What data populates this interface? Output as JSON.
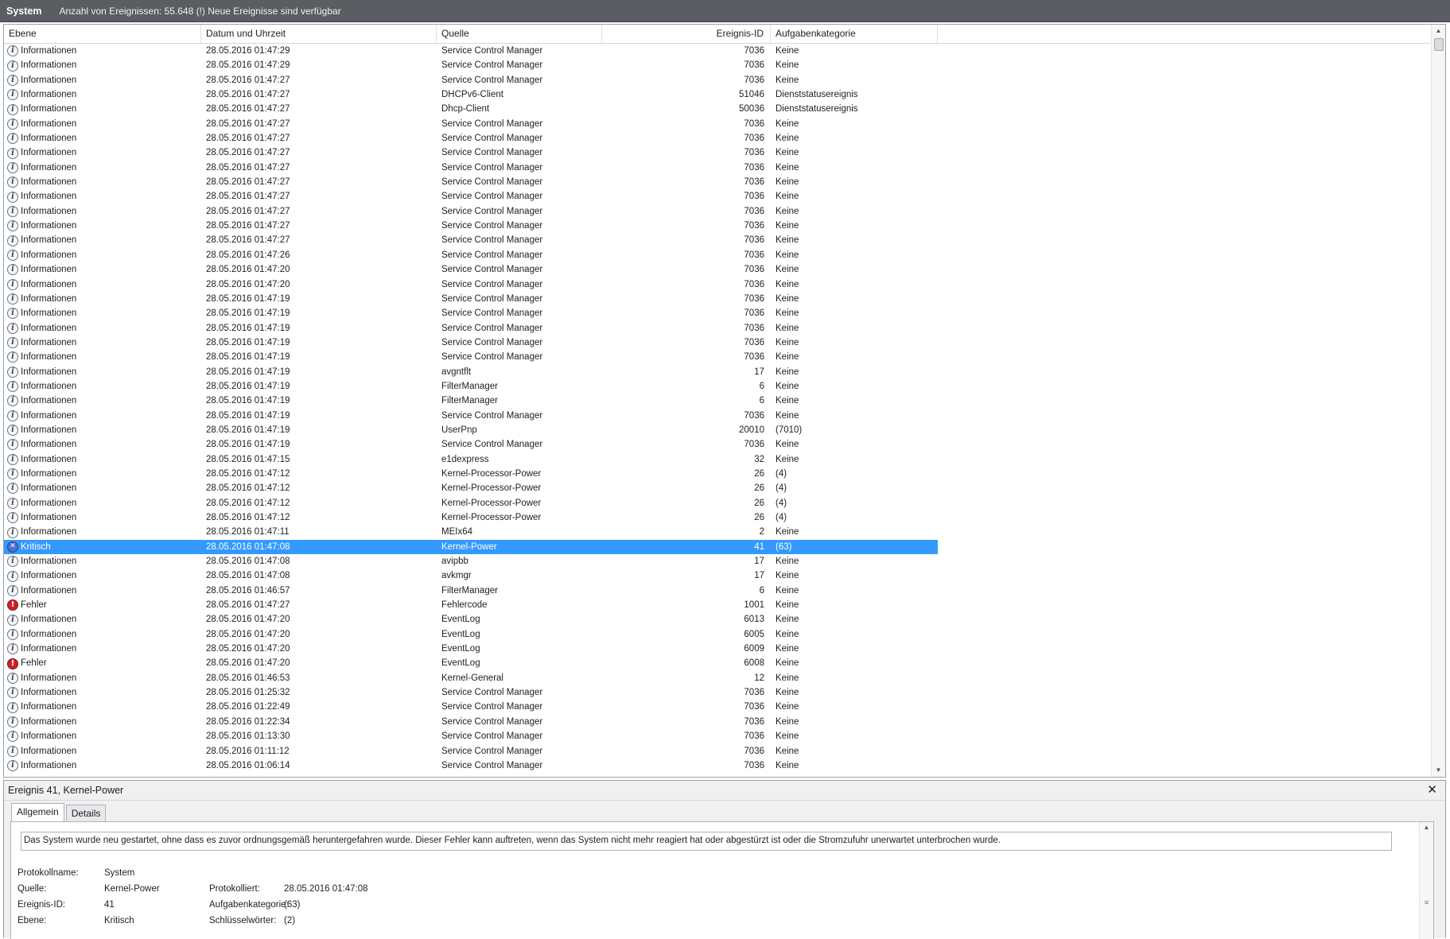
{
  "title": "System",
  "status_text": "Anzahl von Ereignissen: 55.648 (!) Neue Ereignisse sind verfügbar",
  "columns": {
    "level": "Ebene",
    "datetime": "Datum und Uhrzeit",
    "source": "Quelle",
    "event_id": "Ereignis-ID",
    "category": "Aufgabenkategorie"
  },
  "rows": [
    {
      "level": "Informationen",
      "icon": "info",
      "datetime": "28.05.2016 01:47:29",
      "source": "Service Control Manager",
      "event_id": "7036",
      "category": "Keine"
    },
    {
      "level": "Informationen",
      "icon": "info",
      "datetime": "28.05.2016 01:47:29",
      "source": "Service Control Manager",
      "event_id": "7036",
      "category": "Keine"
    },
    {
      "level": "Informationen",
      "icon": "info",
      "datetime": "28.05.2016 01:47:27",
      "source": "Service Control Manager",
      "event_id": "7036",
      "category": "Keine"
    },
    {
      "level": "Informationen",
      "icon": "info",
      "datetime": "28.05.2016 01:47:27",
      "source": "DHCPv6-Client",
      "event_id": "51046",
      "category": "Dienststatusereignis"
    },
    {
      "level": "Informationen",
      "icon": "info",
      "datetime": "28.05.2016 01:47:27",
      "source": "Dhcp-Client",
      "event_id": "50036",
      "category": "Dienststatusereignis"
    },
    {
      "level": "Informationen",
      "icon": "info",
      "datetime": "28.05.2016 01:47:27",
      "source": "Service Control Manager",
      "event_id": "7036",
      "category": "Keine"
    },
    {
      "level": "Informationen",
      "icon": "info",
      "datetime": "28.05.2016 01:47:27",
      "source": "Service Control Manager",
      "event_id": "7036",
      "category": "Keine"
    },
    {
      "level": "Informationen",
      "icon": "info",
      "datetime": "28.05.2016 01:47:27",
      "source": "Service Control Manager",
      "event_id": "7036",
      "category": "Keine"
    },
    {
      "level": "Informationen",
      "icon": "info",
      "datetime": "28.05.2016 01:47:27",
      "source": "Service Control Manager",
      "event_id": "7036",
      "category": "Keine"
    },
    {
      "level": "Informationen",
      "icon": "info",
      "datetime": "28.05.2016 01:47:27",
      "source": "Service Control Manager",
      "event_id": "7036",
      "category": "Keine"
    },
    {
      "level": "Informationen",
      "icon": "info",
      "datetime": "28.05.2016 01:47:27",
      "source": "Service Control Manager",
      "event_id": "7036",
      "category": "Keine"
    },
    {
      "level": "Informationen",
      "icon": "info",
      "datetime": "28.05.2016 01:47:27",
      "source": "Service Control Manager",
      "event_id": "7036",
      "category": "Keine"
    },
    {
      "level": "Informationen",
      "icon": "info",
      "datetime": "28.05.2016 01:47:27",
      "source": "Service Control Manager",
      "event_id": "7036",
      "category": "Keine"
    },
    {
      "level": "Informationen",
      "icon": "info",
      "datetime": "28.05.2016 01:47:27",
      "source": "Service Control Manager",
      "event_id": "7036",
      "category": "Keine"
    },
    {
      "level": "Informationen",
      "icon": "info",
      "datetime": "28.05.2016 01:47:26",
      "source": "Service Control Manager",
      "event_id": "7036",
      "category": "Keine"
    },
    {
      "level": "Informationen",
      "icon": "info",
      "datetime": "28.05.2016 01:47:20",
      "source": "Service Control Manager",
      "event_id": "7036",
      "category": "Keine"
    },
    {
      "level": "Informationen",
      "icon": "info",
      "datetime": "28.05.2016 01:47:20",
      "source": "Service Control Manager",
      "event_id": "7036",
      "category": "Keine"
    },
    {
      "level": "Informationen",
      "icon": "info",
      "datetime": "28.05.2016 01:47:19",
      "source": "Service Control Manager",
      "event_id": "7036",
      "category": "Keine"
    },
    {
      "level": "Informationen",
      "icon": "info",
      "datetime": "28.05.2016 01:47:19",
      "source": "Service Control Manager",
      "event_id": "7036",
      "category": "Keine"
    },
    {
      "level": "Informationen",
      "icon": "info",
      "datetime": "28.05.2016 01:47:19",
      "source": "Service Control Manager",
      "event_id": "7036",
      "category": "Keine"
    },
    {
      "level": "Informationen",
      "icon": "info",
      "datetime": "28.05.2016 01:47:19",
      "source": "Service Control Manager",
      "event_id": "7036",
      "category": "Keine"
    },
    {
      "level": "Informationen",
      "icon": "info",
      "datetime": "28.05.2016 01:47:19",
      "source": "Service Control Manager",
      "event_id": "7036",
      "category": "Keine"
    },
    {
      "level": "Informationen",
      "icon": "info",
      "datetime": "28.05.2016 01:47:19",
      "source": "avgntflt",
      "event_id": "17",
      "category": "Keine"
    },
    {
      "level": "Informationen",
      "icon": "info",
      "datetime": "28.05.2016 01:47:19",
      "source": "FilterManager",
      "event_id": "6",
      "category": "Keine"
    },
    {
      "level": "Informationen",
      "icon": "info",
      "datetime": "28.05.2016 01:47:19",
      "source": "FilterManager",
      "event_id": "6",
      "category": "Keine"
    },
    {
      "level": "Informationen",
      "icon": "info",
      "datetime": "28.05.2016 01:47:19",
      "source": "Service Control Manager",
      "event_id": "7036",
      "category": "Keine"
    },
    {
      "level": "Informationen",
      "icon": "info",
      "datetime": "28.05.2016 01:47:19",
      "source": "UserPnp",
      "event_id": "20010",
      "category": "(7010)"
    },
    {
      "level": "Informationen",
      "icon": "info",
      "datetime": "28.05.2016 01:47:19",
      "source": "Service Control Manager",
      "event_id": "7036",
      "category": "Keine"
    },
    {
      "level": "Informationen",
      "icon": "info",
      "datetime": "28.05.2016 01:47:15",
      "source": "e1dexpress",
      "event_id": "32",
      "category": "Keine"
    },
    {
      "level": "Informationen",
      "icon": "info",
      "datetime": "28.05.2016 01:47:12",
      "source": "Kernel-Processor-Power",
      "event_id": "26",
      "category": "(4)"
    },
    {
      "level": "Informationen",
      "icon": "info",
      "datetime": "28.05.2016 01:47:12",
      "source": "Kernel-Processor-Power",
      "event_id": "26",
      "category": "(4)"
    },
    {
      "level": "Informationen",
      "icon": "info",
      "datetime": "28.05.2016 01:47:12",
      "source": "Kernel-Processor-Power",
      "event_id": "26",
      "category": "(4)"
    },
    {
      "level": "Informationen",
      "icon": "info",
      "datetime": "28.05.2016 01:47:12",
      "source": "Kernel-Processor-Power",
      "event_id": "26",
      "category": "(4)"
    },
    {
      "level": "Informationen",
      "icon": "info",
      "datetime": "28.05.2016 01:47:11",
      "source": "MEIx64",
      "event_id": "2",
      "category": "Keine"
    },
    {
      "level": "Kritisch",
      "icon": "crit",
      "datetime": "28.05.2016 01:47:08",
      "source": "Kernel-Power",
      "event_id": "41",
      "category": "(63)",
      "selected": true
    },
    {
      "level": "Informationen",
      "icon": "info",
      "datetime": "28.05.2016 01:47:08",
      "source": "avipbb",
      "event_id": "17",
      "category": "Keine"
    },
    {
      "level": "Informationen",
      "icon": "info",
      "datetime": "28.05.2016 01:47:08",
      "source": "avkmgr",
      "event_id": "17",
      "category": "Keine"
    },
    {
      "level": "Informationen",
      "icon": "info",
      "datetime": "28.05.2016 01:46:57",
      "source": "FilterManager",
      "event_id": "6",
      "category": "Keine"
    },
    {
      "level": "Fehler",
      "icon": "err",
      "datetime": "28.05.2016 01:47:27",
      "source": "Fehlercode",
      "event_id": "1001",
      "category": "Keine"
    },
    {
      "level": "Informationen",
      "icon": "info",
      "datetime": "28.05.2016 01:47:20",
      "source": "EventLog",
      "event_id": "6013",
      "category": "Keine"
    },
    {
      "level": "Informationen",
      "icon": "info",
      "datetime": "28.05.2016 01:47:20",
      "source": "EventLog",
      "event_id": "6005",
      "category": "Keine"
    },
    {
      "level": "Informationen",
      "icon": "info",
      "datetime": "28.05.2016 01:47:20",
      "source": "EventLog",
      "event_id": "6009",
      "category": "Keine"
    },
    {
      "level": "Fehler",
      "icon": "err",
      "datetime": "28.05.2016 01:47:20",
      "source": "EventLog",
      "event_id": "6008",
      "category": "Keine"
    },
    {
      "level": "Informationen",
      "icon": "info",
      "datetime": "28.05.2016 01:46:53",
      "source": "Kernel-General",
      "event_id": "12",
      "category": "Keine"
    },
    {
      "level": "Informationen",
      "icon": "info",
      "datetime": "28.05.2016 01:25:32",
      "source": "Service Control Manager",
      "event_id": "7036",
      "category": "Keine"
    },
    {
      "level": "Informationen",
      "icon": "info",
      "datetime": "28.05.2016 01:22:49",
      "source": "Service Control Manager",
      "event_id": "7036",
      "category": "Keine"
    },
    {
      "level": "Informationen",
      "icon": "info",
      "datetime": "28.05.2016 01:22:34",
      "source": "Service Control Manager",
      "event_id": "7036",
      "category": "Keine"
    },
    {
      "level": "Informationen",
      "icon": "info",
      "datetime": "28.05.2016 01:13:30",
      "source": "Service Control Manager",
      "event_id": "7036",
      "category": "Keine"
    },
    {
      "level": "Informationen",
      "icon": "info",
      "datetime": "28.05.2016 01:11:12",
      "source": "Service Control Manager",
      "event_id": "7036",
      "category": "Keine"
    },
    {
      "level": "Informationen",
      "icon": "info",
      "datetime": "28.05.2016 01:06:14",
      "source": "Service Control Manager",
      "event_id": "7036",
      "category": "Keine"
    }
  ],
  "detail": {
    "header": "Ereignis 41, Kernel-Power",
    "close_label": "✕",
    "tabs": [
      "Allgemein",
      "Details"
    ],
    "message": "Das System wurde neu gestartet, ohne dass es zuvor ordnungsgemäß heruntergefahren wurde. Dieser Fehler kann auftreten, wenn das System nicht mehr reagiert hat oder abgestürzt ist oder die Stromzufuhr unerwartet unterbrochen wurde.",
    "fields": {
      "log_name_label": "Protokollname:",
      "log_name": "System",
      "source_label": "Quelle:",
      "source": "Kernel-Power",
      "logged_label": "Protokolliert:",
      "logged": "28.05.2016 01:47:08",
      "event_id_label": "Ereignis-ID:",
      "event_id": "41",
      "category_label": "Aufgabenkategorie:",
      "category": "(63)",
      "level_label": "Ebene:",
      "level": "Kritisch",
      "keywords_label": "Schlüsselwörter:",
      "keywords": "(2)"
    }
  },
  "colors": {
    "selection": "#3399ff",
    "titlebar": "#5a5d61",
    "error": "#c8242c",
    "critical": "#4d6fd0"
  },
  "icons": {
    "info": "information-icon",
    "crit": "critical-icon",
    "err": "error-icon"
  }
}
